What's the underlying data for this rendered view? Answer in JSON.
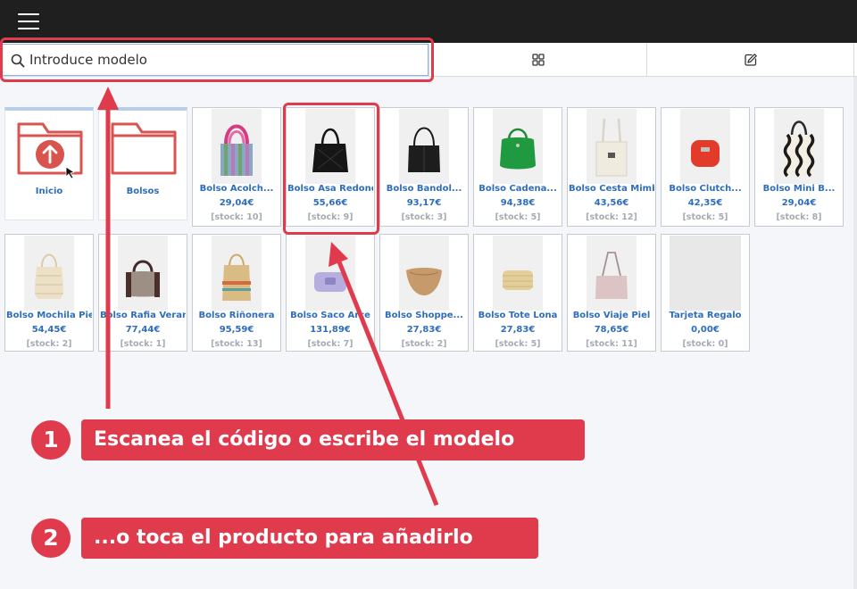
{
  "toolbar": {
    "search_placeholder": "Introduce modelo",
    "search_value": ""
  },
  "folders": [
    {
      "label": "Inicio",
      "icon": "folder-up-icon"
    },
    {
      "label": "Bolsos",
      "icon": "folder-icon"
    }
  ],
  "products": [
    {
      "name": "Bolso Acolch...",
      "price": "29,04€",
      "stock": "[stock: 10]"
    },
    {
      "name": "Bolso Asa Redond",
      "price": "55,66€",
      "stock": "[stock: 9]"
    },
    {
      "name": "Bolso Bandol...",
      "price": "93,17€",
      "stock": "[stock: 3]"
    },
    {
      "name": "Bolso Cadena...",
      "price": "94,38€",
      "stock": "[stock: 5]"
    },
    {
      "name": "Bolso Cesta Mimb",
      "price": "43,56€",
      "stock": "[stock: 12]"
    },
    {
      "name": "Bolso Clutch...",
      "price": "42,35€",
      "stock": "[stock: 5]"
    },
    {
      "name": "Bolso Mini B...",
      "price": "29,04€",
      "stock": "[stock: 8]"
    },
    {
      "name": "Bolso Mochila Pie",
      "price": "54,45€",
      "stock": "[stock: 2]"
    },
    {
      "name": "Bolso Rafia Veran",
      "price": "77,44€",
      "stock": "[stock: 1]"
    },
    {
      "name": "Bolso Riñonera",
      "price": "95,59€",
      "stock": "[stock: 13]"
    },
    {
      "name": "Bolso Saco Arce",
      "price": "131,89€",
      "stock": "[stock: 7]"
    },
    {
      "name": "Bolso Shoppe...",
      "price": "27,83€",
      "stock": "[stock: 2]"
    },
    {
      "name": "Bolso Tote Lona",
      "price": "27,83€",
      "stock": "[stock: 5]"
    },
    {
      "name": "Bolso Viaje Piel",
      "price": "78,65€",
      "stock": "[stock: 11]"
    },
    {
      "name": "Tarjeta Regalo",
      "price": "0,00€",
      "stock": "[stock: 0]"
    }
  ],
  "annotations": {
    "step1": {
      "number": "1",
      "text": "Escanea el código o escribe el modelo"
    },
    "step2": {
      "number": "2",
      "text": "...o toca el producto para añadirlo"
    }
  },
  "colors": {
    "accent": "#e03a4d",
    "link": "#2e6dbb",
    "topbar": "#1f1f1f"
  }
}
